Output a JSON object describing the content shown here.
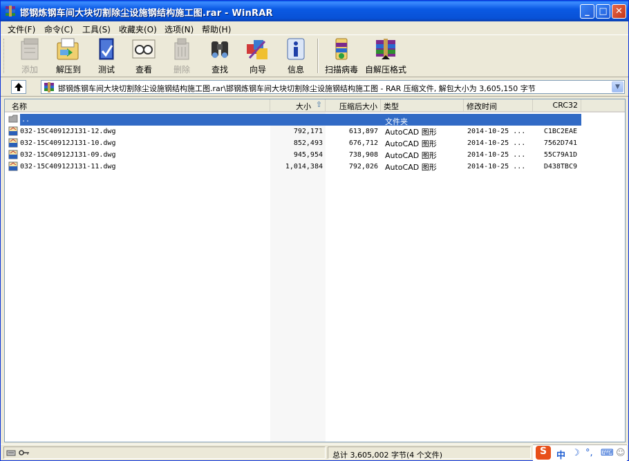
{
  "window": {
    "title": "邯钢炼钢车间大块切割除尘设施钢结构施工图.rar - WinRAR",
    "controls": {
      "minimize": "_",
      "maximize": "□",
      "close": "✕"
    }
  },
  "menu": [
    {
      "label": "文件(F)"
    },
    {
      "label": "命令(C)"
    },
    {
      "label": "工具(S)"
    },
    {
      "label": "收藏夹(O)"
    },
    {
      "label": "选项(N)"
    },
    {
      "label": "帮助(H)"
    }
  ],
  "toolbar": {
    "buttons": [
      {
        "label": "添加",
        "icon": "add-icon",
        "enabled": false
      },
      {
        "label": "解压到",
        "icon": "extract-icon",
        "enabled": true
      },
      {
        "label": "测试",
        "icon": "test-icon",
        "enabled": true
      },
      {
        "label": "查看",
        "icon": "view-icon",
        "enabled": true
      },
      {
        "label": "删除",
        "icon": "delete-icon",
        "enabled": false
      },
      {
        "label": "查找",
        "icon": "find-icon",
        "enabled": true
      },
      {
        "label": "向导",
        "icon": "wizard-icon",
        "enabled": true
      },
      {
        "label": "信息",
        "icon": "info-icon",
        "enabled": true
      },
      {
        "label": "扫描病毒",
        "icon": "virus-scan-icon",
        "enabled": true
      },
      {
        "label": "自解压格式",
        "icon": "sfx-icon",
        "enabled": true
      }
    ]
  },
  "address": {
    "path": "邯钢炼钢车间大块切割除尘设施钢结构施工图.rar\\邯钢炼钢车间大块切割除尘设施钢结构施工图 - RAR 压缩文件, 解包大小为 3,605,150 字节"
  },
  "columns": {
    "name": "名称",
    "size": "大小",
    "packed": "压缩后大小",
    "type": "类型",
    "modified": "修改时间",
    "crc": "CRC32"
  },
  "parent_row": {
    "name": "..",
    "type": "文件夹"
  },
  "files": [
    {
      "name": "032-15C40912J131-12.dwg",
      "size": "792,171",
      "packed": "613,897",
      "type": "AutoCAD 图形",
      "modified": "2014-10-25 ...",
      "crc": "C1BC2EAE"
    },
    {
      "name": "032-15C40912J131-10.dwg",
      "size": "852,493",
      "packed": "676,712",
      "type": "AutoCAD 图形",
      "modified": "2014-10-25 ...",
      "crc": "7562D741"
    },
    {
      "name": "032-15C40912J131-09.dwg",
      "size": "945,954",
      "packed": "738,908",
      "type": "AutoCAD 图形",
      "modified": "2014-10-25 ...",
      "crc": "55C79A1D"
    },
    {
      "name": "032-15C40912J131-11.dwg",
      "size": "1,014,384",
      "packed": "792,026",
      "type": "AutoCAD 图形",
      "modified": "2014-10-25 ...",
      "crc": "D438TBC9"
    }
  ],
  "status": {
    "summary": "总计 3,605,002 字节(4 个文件)"
  },
  "ime": {
    "zh": "中",
    "moon": "☽",
    "punct": "°,",
    "keyboard": "⌨",
    "user": "☺"
  },
  "colors": {
    "selection": "#316ac5",
    "titlebar": "#0a5ee8"
  }
}
